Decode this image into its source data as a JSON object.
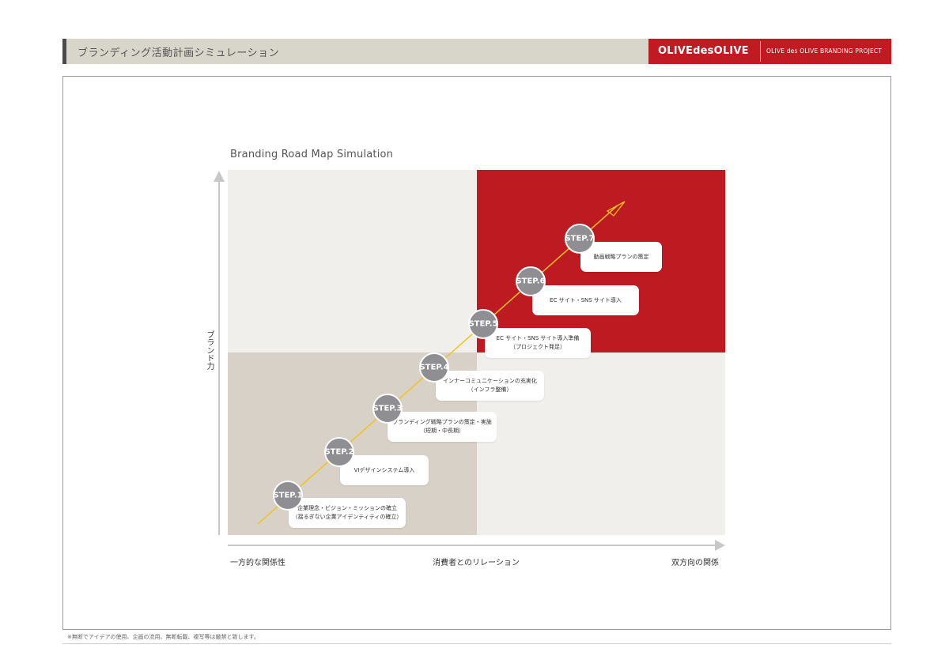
{
  "header": {
    "title": "ブランディング活動計画シミュレーション",
    "brand_logo": "OLIVEdesOLIVE",
    "brand_subtitle": "OLIVE des OLIVE BRANDING PROJECT"
  },
  "diagram": {
    "title": "Branding Road Map Simulation",
    "y_axis_label": "ブランド力",
    "x_axis_label": "消費者とのリレーション",
    "x_axis_left": "一方的な関係性",
    "x_axis_right": "双方向の関係",
    "steps": [
      {
        "label": "STEP.1",
        "lines": [
          "企業理念・ビジョン・ミッションの確立",
          "（揺るぎない企業アイデンティティの確立）"
        ]
      },
      {
        "label": "STEP.2",
        "lines": [
          "VIデザインシステム導入"
        ]
      },
      {
        "label": "STEP.3",
        "lines": [
          "ブランディング戦略プランの策定・実施",
          "（短期・中長期）"
        ]
      },
      {
        "label": "STEP.4",
        "lines": [
          "インナーコミュニケーションの充実化",
          "（インフラ整備）"
        ]
      },
      {
        "label": "STEP.5",
        "lines": [
          "EC サイト・SNS サイト導入準備",
          "（プロジェクト発足）"
        ]
      },
      {
        "label": "STEP.6",
        "lines": [
          "EC サイト・SNS サイト導入"
        ]
      },
      {
        "label": "STEP.7",
        "lines": [
          "動画戦略プランの策定"
        ]
      }
    ]
  },
  "colors": {
    "brand_red": "#c01b22",
    "quadrant_light": "#f0efec",
    "quadrant_beige": "#d7d1c8",
    "step_gray": "#8e8e93",
    "roadmap_line": "#f0c419"
  },
  "footer": {
    "note": "※無断でアイデアの使用、企画の流用、無断転載、複写等は厳禁と致します。"
  }
}
